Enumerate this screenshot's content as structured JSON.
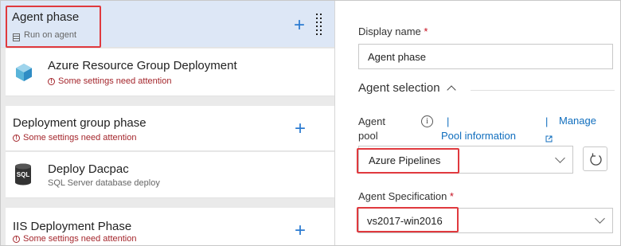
{
  "phases": {
    "agent_phase": {
      "title": "Agent phase",
      "subtitle": "Run on agent"
    },
    "azure_task": {
      "title": "Azure Resource Group Deployment",
      "warning": "Some settings need attention"
    },
    "deployment_group": {
      "title": "Deployment group phase",
      "warning": "Some settings need attention"
    },
    "dacpac_task": {
      "title": "Deploy Dacpac",
      "subtitle": "SQL Server database deploy",
      "icon_text": "SQL"
    },
    "iis_phase": {
      "title": "IIS Deployment Phase",
      "warning": "Some settings need attention"
    }
  },
  "properties": {
    "display_name_label": "Display name",
    "required_mark": "*",
    "display_name_value": "Agent phase",
    "agent_selection_title": "Agent selection",
    "agent_pool_label_line1": "Agent",
    "agent_pool_label_line2": "pool",
    "pool_information_link": "Pool information",
    "manage_link": "Manage",
    "pipe_char": "|",
    "agent_pool_value": "Azure Pipelines",
    "agent_spec_label": "Agent Specification",
    "agent_spec_value": "vs2017-win2016"
  },
  "colors": {
    "accent": "#2b7bd1",
    "selected_bg": "#dde7f6",
    "highlight": "#e0393e",
    "warning": "#a4262c"
  }
}
